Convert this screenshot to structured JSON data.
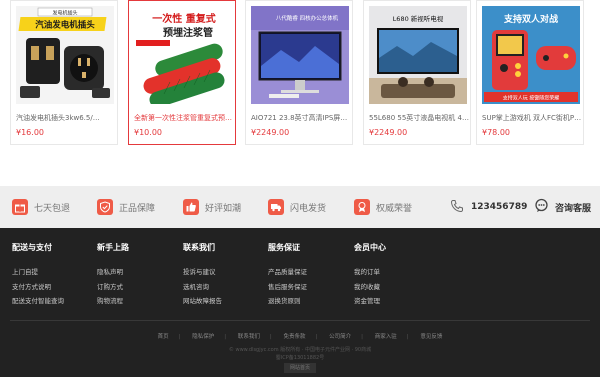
{
  "products": [
    {
      "name": "汽油发电机插头3kw6.5/…",
      "price": "¥16.00",
      "banner": "汽油发电机插头",
      "banner_top": "发电机插头"
    },
    {
      "name": "全新第一次性注浆管重复式预埋…",
      "price": "¥10.00",
      "banner": "一次性 重复式",
      "banner2": "预埋注浆管"
    },
    {
      "name": "AIO721 23.8英寸高清IPS屏办公…",
      "price": "¥2249.00",
      "banner": "八代酷睿 四核办公总体机"
    },
    {
      "name": "55L680 55英寸液晶电视机 4k超…",
      "price": "¥2249.00",
      "banner": "L680 新视听电视"
    },
    {
      "name": "SUP掌上游戏机 双人FC街机PSP…",
      "price": "¥78.00",
      "banner": "支持双人对战",
      "banner2": "支持双人玩 按键随您荣耀"
    }
  ],
  "services": [
    {
      "label": "七天包退",
      "icon": "gift-icon"
    },
    {
      "label": "正品保障",
      "icon": "shield-check-icon"
    },
    {
      "label": "好评如潮",
      "icon": "thumbs-up-icon"
    },
    {
      "label": "闪电发货",
      "icon": "truck-icon"
    },
    {
      "label": "权威荣誉",
      "icon": "award-icon"
    }
  ],
  "phone": {
    "number": "123456789"
  },
  "customer_service": {
    "label": "咨询客服"
  },
  "footer_columns": [
    {
      "title": "配送与支付",
      "links": [
        "上门自提",
        "支付方式说明",
        "配送支付智能查询"
      ]
    },
    {
      "title": "新手上路",
      "links": [
        "隐私声明",
        "订购方式",
        "购物流程"
      ]
    },
    {
      "title": "联系我们",
      "links": [
        "投诉与建议",
        "选机咨询",
        "网站故障报告"
      ]
    },
    {
      "title": "服务保证",
      "links": [
        "产品质量保证",
        "售后服务保证",
        "退换货原则"
      ]
    },
    {
      "title": "会员中心",
      "links": [
        "我的订单",
        "我的收藏",
        "资金管理"
      ]
    }
  ],
  "bottom_links": [
    "首页",
    "隐私保护",
    "联系我们",
    "免责条款",
    "公司简介",
    "商家入驻",
    "意见反馈"
  ],
  "copyright": {
    "line1": "© www.dlsgjyc.com 版权所有 · 中国电子元件产业网 · 90商城",
    "line2": "蜀ICP备13011882号",
    "site_button": "网站首页"
  },
  "colors": {
    "accent": "#e4393c",
    "service_icon": "#ef5b47",
    "footer_bg": "#222222"
  }
}
